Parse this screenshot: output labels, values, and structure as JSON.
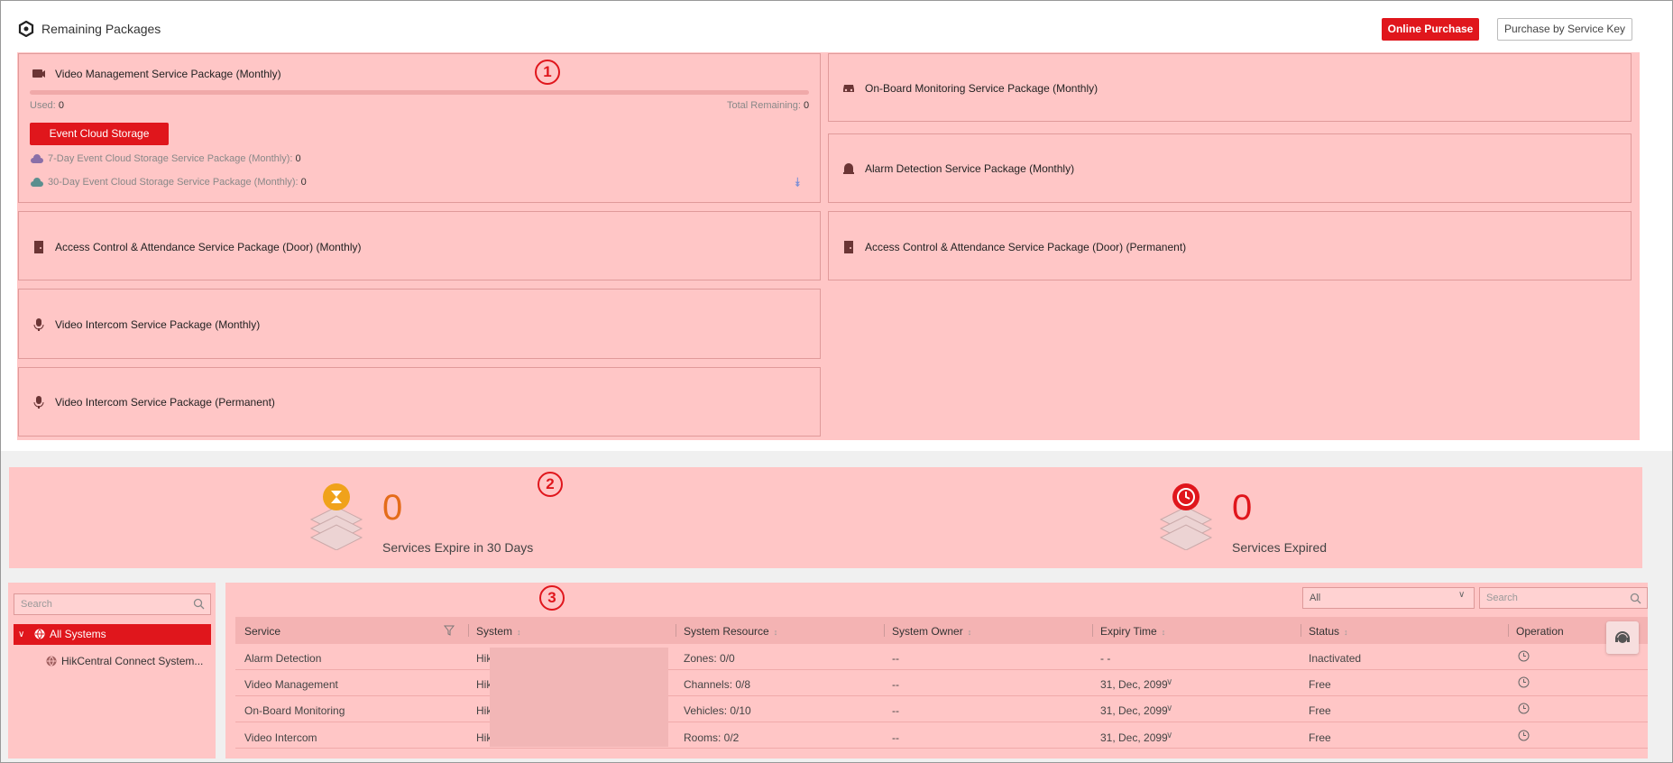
{
  "header": {
    "title": "Remaining Packages",
    "online_purchase": "Online Purchase",
    "purchase_by_key": "Purchase by Service Key"
  },
  "markers": {
    "m1": "1",
    "m2": "2",
    "m3": "3"
  },
  "packages": {
    "vms": {
      "title": "Video Management Service Package (Monthly)",
      "used_label": "Used:",
      "used_value": "0",
      "remaining_label": "Total Remaining:",
      "remaining_value": "0",
      "event_button": "Event Cloud Storage",
      "seven_day": "7-Day Event Cloud Storage Service Package (Monthly):",
      "seven_day_value": "0",
      "thirty_day": "30-Day Event Cloud Storage Service Package (Monthly):",
      "thirty_day_value": "0"
    },
    "onboard": "On-Board Monitoring Service Package (Monthly)",
    "alarm": "Alarm Detection Service Package (Monthly)",
    "access_monthly": "Access Control & Attendance Service Package (Door) (Monthly)",
    "access_perm": "Access Control & Attendance Service Package (Door) (Permanent)",
    "intercom_monthly": "Video Intercom Service Package (Monthly)",
    "intercom_perm": "Video Intercom Service Package (Permanent)"
  },
  "stats": {
    "expire30_value": "0",
    "expire30_label": "Services Expire in 30 Days",
    "expired_value": "0",
    "expired_label": "Services Expired",
    "colors": {
      "expire30": "#e46c1a",
      "expired": "#e0161c"
    }
  },
  "tree": {
    "search_placeholder": "Search",
    "all_systems": "All Systems",
    "child": "HikCentral Connect System..."
  },
  "filter": {
    "selected": "All",
    "search_placeholder": "Search"
  },
  "table": {
    "columns": [
      "Service",
      "System",
      "System Resource",
      "System Owner",
      "Expiry Time",
      "Status",
      "Operation"
    ],
    "rows": [
      {
        "service": "Alarm Detection",
        "system": "Hik",
        "resource": "Zones: 0/0",
        "owner": "--",
        "expiry": "- -",
        "status": "Inactivated"
      },
      {
        "service": "Video Management",
        "system": "Hik",
        "resource": "Channels: 0/8",
        "owner": "--",
        "expiry": "31, Dec, 2099",
        "status": "Free"
      },
      {
        "service": "On-Board Monitoring",
        "system": "Hik",
        "resource": "Vehicles: 0/10",
        "owner": "--",
        "expiry": "31, Dec, 2099",
        "status": "Free"
      },
      {
        "service": "Video Intercom",
        "system": "Hik",
        "resource": "Rooms: 0/2",
        "owner": "--",
        "expiry": "31, Dec, 2099",
        "status": "Free"
      }
    ]
  },
  "accent": "#e0161c"
}
